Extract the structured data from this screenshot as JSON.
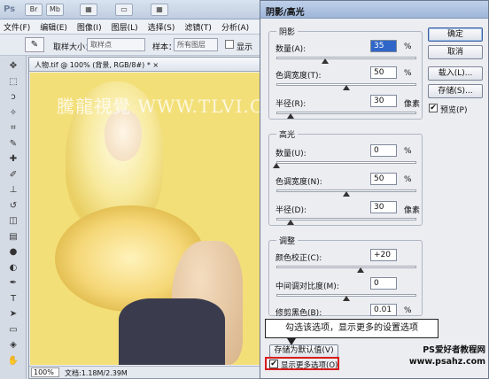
{
  "app": {
    "logo": "Ps",
    "titlebar_buttons": [
      "Br",
      "Mb",
      "▦",
      "▭",
      "▦"
    ],
    "menu": [
      "文件(F)",
      "编辑(E)",
      "图像(I)",
      "图层(L)",
      "选择(S)",
      "滤镜(T)",
      "分析(A)"
    ],
    "options": {
      "sample_size_label": "取样大小：",
      "sample_size_value": "取样点",
      "sample_label": "样本：",
      "sample_value": "所有图层",
      "show_ring_label": "显示"
    },
    "tools": [
      "move-icon",
      "marquee-icon",
      "lasso-icon",
      "quick-select-icon",
      "crop-icon",
      "eyedropper-icon",
      "healing-icon",
      "brush-icon",
      "stamp-icon",
      "history-brush-icon",
      "eraser-icon",
      "gradient-icon",
      "blur-icon",
      "dodge-icon",
      "pen-icon",
      "type-icon",
      "path-select-icon",
      "shape-icon",
      "3d-icon",
      "hand-icon"
    ],
    "document": {
      "tab_title": "人物.tif @ 100% (背景, RGB/8#) *  ×",
      "watermark": "騰龍視覺  WWW.TLVI.COM",
      "zoom": "100%",
      "doc_size": "文档:1.18M/2.39M"
    }
  },
  "dialog": {
    "title": "阴影/高光",
    "buttons": {
      "ok": "确定",
      "cancel": "取消",
      "load": "载入(L)...",
      "save": "存储(S)..."
    },
    "preview": {
      "label": "预览(P)",
      "checked": true
    },
    "shadows": {
      "title": "阴影",
      "amount": {
        "label": "数量(A):",
        "value": "35",
        "unit": "%",
        "level": 0.35
      },
      "tonal_width": {
        "label": "色调宽度(T):",
        "value": "50",
        "unit": "%",
        "level": 0.5
      },
      "radius": {
        "label": "半径(R):",
        "value": "30",
        "unit": "像素",
        "level": 0.1
      }
    },
    "highlights": {
      "title": "高光",
      "amount": {
        "label": "数量(U):",
        "value": "0",
        "unit": "%",
        "level": 0.0
      },
      "tonal_width": {
        "label": "色调宽度(N):",
        "value": "50",
        "unit": "%",
        "level": 0.5
      },
      "radius": {
        "label": "半径(D):",
        "value": "30",
        "unit": "像素",
        "level": 0.1
      }
    },
    "adjustments": {
      "title": "调整",
      "color_correction": {
        "label": "颜色校正(C):",
        "value": "+20",
        "unit": "",
        "level": 0.6
      },
      "midtone_contrast": {
        "label": "中间调对比度(M):",
        "value": "0",
        "unit": "",
        "level": 0.5
      },
      "black_clip": {
        "label": "修剪黑色(B):",
        "value": "0.01",
        "unit": "%",
        "level": 0.0
      }
    },
    "save_default": "存储为默认值(V)",
    "show_more": {
      "label": "显示更多选项(O)",
      "checked": true
    },
    "callout": "勾选该选项，显示更多的设置选项",
    "site_mark_line1": "PS爱好者教程网",
    "site_mark_line2": "www.psahz.com",
    "colors": {
      "highlight_box": "#d81c1c",
      "selection": "#2f66c8"
    }
  }
}
